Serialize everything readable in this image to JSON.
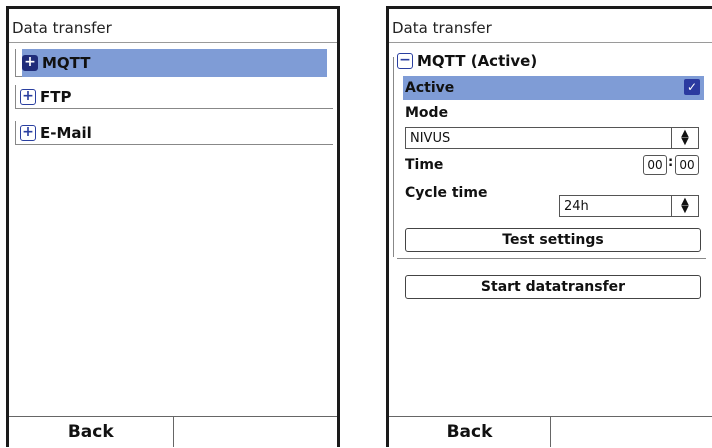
{
  "left": {
    "title": "Data transfer",
    "items": [
      {
        "label": "MQTT",
        "icon": "plus-box-icon",
        "selected": true
      },
      {
        "label": "FTP",
        "icon": "plus-box-icon",
        "selected": false
      },
      {
        "label": "E-Mail",
        "icon": "plus-box-icon",
        "selected": false
      }
    ],
    "footer": {
      "left_label": "Back",
      "right_label": ""
    }
  },
  "right": {
    "title": "Data transfer",
    "section_label": "MQTT (Active)",
    "section_icon": "minus-box-icon",
    "active_label": "Active",
    "active_checked": true,
    "mode_label": "Mode",
    "mode_value": "NIVUS",
    "time_label": "Time",
    "time_hours": "00",
    "time_minutes": "00",
    "time_separator": ":",
    "cycle_label": "Cycle time",
    "cycle_value": "24h",
    "test_button": "Test settings",
    "start_button": "Start datatransfer",
    "footer": {
      "left_label": "Back",
      "right_label": ""
    }
  },
  "colors": {
    "selection": "#7f9cd6",
    "icon": "#1f2c7a",
    "checkbox": "#2b3aa0"
  }
}
